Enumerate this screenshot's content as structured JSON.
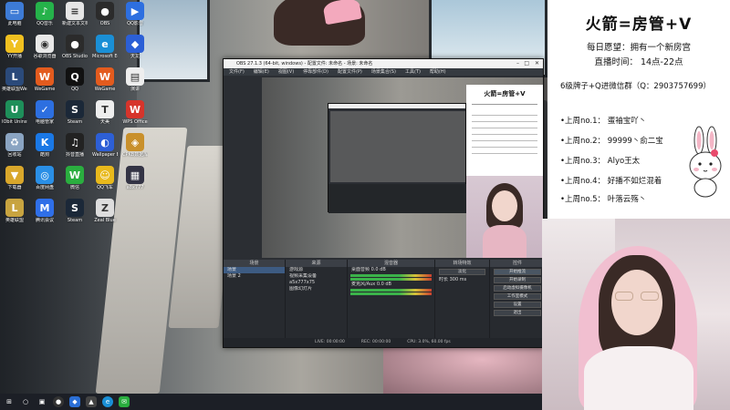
{
  "desktop": {
    "icons": [
      {
        "label": "此电脑",
        "name": "this-pc",
        "color": "#3d7bd6",
        "glyph": "▭"
      },
      {
        "label": "YY开播",
        "name": "yy",
        "color": "#f0c020",
        "glyph": "Y"
      },
      {
        "label": "英雄联盟WeGame版",
        "name": "lol-wegame",
        "color": "#2b4a7a",
        "glyph": "L"
      },
      {
        "label": "IObit Uninstaller",
        "name": "iobit",
        "color": "#1e8f5a",
        "glyph": "U"
      },
      {
        "label": "回收站",
        "name": "recycle-bin",
        "color": "#8aa4c2",
        "glyph": "♻"
      },
      {
        "label": "下载器",
        "name": "app-2",
        "color": "#d9a72b",
        "glyph": "▼"
      },
      {
        "label": "英雄联盟",
        "name": "lol",
        "color": "#c8a440",
        "glyph": "L"
      },
      {
        "label": "QQ音乐",
        "name": "qq-music",
        "color": "#25b24a",
        "glyph": "♪"
      },
      {
        "label": "谷歌浏览器",
        "name": "chrome",
        "color": "#e8e8e8",
        "glyph": "◉"
      },
      {
        "label": "WeGame",
        "name": "wegame",
        "color": "#e35b1e",
        "glyph": "W"
      },
      {
        "label": "电脑管家",
        "name": "pc-manager",
        "color": "#2d6fe0",
        "glyph": "✓"
      },
      {
        "label": "酷狗",
        "name": "kugou",
        "color": "#1a78e6",
        "glyph": "K"
      },
      {
        "label": "百度网盘",
        "name": "baidu-pan",
        "color": "#2a8fe6",
        "glyph": "◎"
      },
      {
        "label": "腾讯会议",
        "name": "tencent-meeting",
        "color": "#2f6fe8",
        "glyph": "M"
      },
      {
        "label": "新建文本文档",
        "name": "text-doc",
        "color": "#e6e6e6",
        "glyph": "≡"
      },
      {
        "label": "OBS Studio",
        "name": "obs",
        "color": "#2b2b2b",
        "glyph": "●"
      },
      {
        "label": "QQ",
        "name": "qq",
        "color": "#111",
        "glyph": "Q"
      },
      {
        "label": "Steam",
        "name": "steam",
        "color": "#1b2838",
        "glyph": "S"
      },
      {
        "label": "抖音直播",
        "name": "douyin",
        "color": "#222",
        "glyph": "♫"
      },
      {
        "label": "微信",
        "name": "wechat",
        "color": "#2aae3f",
        "glyph": "W"
      },
      {
        "label": "Steam",
        "name": "steam-2",
        "color": "#1b2838",
        "glyph": "S"
      },
      {
        "label": "OBS",
        "name": "obs-2",
        "color": "#2b2b2b",
        "glyph": "●"
      },
      {
        "label": "Microsoft Edge",
        "name": "edge",
        "color": "#1a8fd6",
        "glyph": "e"
      },
      {
        "label": "WeGame",
        "name": "wegame-2",
        "color": "#e35b1e",
        "glyph": "W"
      },
      {
        "label": "天美",
        "name": "tianmei",
        "color": "#eee",
        "glyph": "T"
      },
      {
        "label": "Wallpaper Engine",
        "name": "wallpaper",
        "color": "#2d5fd6",
        "glyph": "◐"
      },
      {
        "label": "QQ飞车",
        "name": "qq-speed",
        "color": "#e8b91c",
        "glyph": "☺"
      },
      {
        "label": "Zeal Blue",
        "name": "zeal",
        "color": "#ddd",
        "glyph": "Z"
      },
      {
        "label": "QQ影音",
        "name": "qq-player",
        "color": "#2d6fe0",
        "glyph": "▶"
      },
      {
        "label": "天龙",
        "name": "tianlong",
        "color": "#2b5fd6",
        "glyph": "◆"
      },
      {
        "label": "演讲",
        "name": "speech",
        "color": "#eee",
        "glyph": "▤"
      },
      {
        "label": "WPS Office",
        "name": "wps",
        "color": "#d6342b",
        "glyph": "W"
      },
      {
        "label": "CPKB数据库",
        "name": "cpkb",
        "color": "#c9902b",
        "glyph": "◈"
      },
      {
        "label": "a8x777",
        "name": "a8",
        "color": "#334",
        "glyph": "▦"
      }
    ]
  },
  "obs": {
    "title": "OBS 27.1.3 (64-bit, windows) - 配置文件: 未命名 - 场景: 未命名",
    "menu": [
      "文件(F)",
      "编辑(E)",
      "视图(V)",
      "停靠部件(D)",
      "配置文件(P)",
      "场景集合(S)",
      "工具(T)",
      "帮助(H)"
    ],
    "docks": {
      "scenes": {
        "header": "场景",
        "items": [
          "场景",
          "场景 2"
        ]
      },
      "sources": {
        "header": "来源",
        "items": [
          "游戏源",
          "视频采集设备",
          "a5x777x75",
          "图像幻灯片"
        ]
      },
      "mixer": {
        "header": "混音器",
        "channels": [
          {
            "label": "桌面音频",
            "db": "0.0 dB"
          },
          {
            "label": "麦克风/Aux",
            "db": "0.0 dB"
          }
        ]
      },
      "transitions": {
        "header": "转场特效",
        "type": "淡化",
        "duration_label": "时长",
        "duration": "300 ms"
      },
      "controls": {
        "header": "控件",
        "buttons": [
          "开始推流",
          "开始录制",
          "启动虚拟摄像机",
          "工作室模式",
          "设置",
          "退出"
        ]
      }
    },
    "status": {
      "live": "LIVE: 00:00:00",
      "rec": "REC: 00:00:00",
      "cpu": "CPU: 3.0%, 60.00 fps"
    },
    "preview_nested_title": "火箭=房管+V"
  },
  "taskbar": {
    "items": [
      "start",
      "search",
      "task-view",
      "obs",
      "app",
      "app2",
      "edge",
      "wechat"
    ]
  },
  "board": {
    "title": "火箭=房管+V",
    "wish": "每日愿望：拥有一个新房宫",
    "hours": "直播时间： 14点-22点",
    "qq": "6级牌子+Q进微信群（Q：2903757699）",
    "ranks": [
      "•上周no.1： 蛋袖宝吖丶",
      "•上周no.2： 99999丶俞二宝",
      "•上周no.3： Alyo王太",
      "•上周no.4： 好播不如烂混着",
      "•上周no.5： 叶落云殇丶"
    ]
  },
  "colors": {
    "board_bg": "#ffffff",
    "obs_bg": "#2b2e33",
    "taskbar": "#1c1f26",
    "accent_pink": "#f2b7c8"
  }
}
